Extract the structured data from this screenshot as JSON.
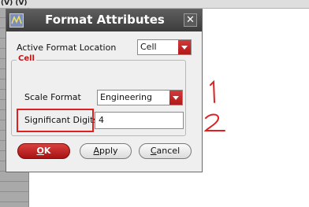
{
  "background": {
    "header_text": "(V) (V)"
  },
  "dialog": {
    "title": "Format Attributes",
    "close_glyph": "✕",
    "active_format_location": {
      "label": "Active Format Location",
      "selected": "Cell"
    },
    "group": {
      "title": "Cell",
      "scale_format": {
        "label": "Scale Format",
        "selected": "Engineering"
      },
      "significant_digits": {
        "label": "Significant Digits",
        "value": "4"
      }
    },
    "buttons": {
      "ok": {
        "first": "O",
        "rest": "K"
      },
      "apply": {
        "first": "A",
        "rest": "pply"
      },
      "cancel": {
        "first": "C",
        "rest": "ancel"
      }
    }
  },
  "annotations": {
    "marks": [
      "1",
      "2"
    ],
    "color": "#e02020"
  },
  "colors": {
    "accent_red": "#c01818",
    "titlebar": "#4a4a4a",
    "dialog_bg": "#efefef"
  }
}
